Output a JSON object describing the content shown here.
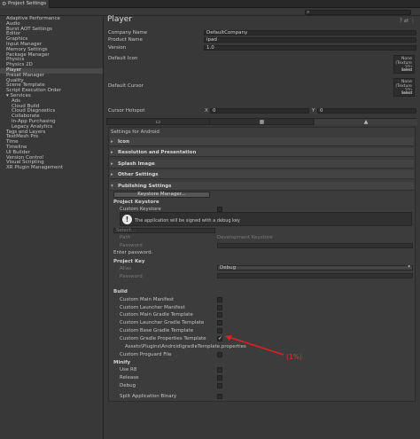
{
  "window": {
    "tab_title": "Project Settings"
  },
  "sidebar": {
    "items": [
      {
        "label": "Adaptive Performance",
        "sub": false,
        "selected": false
      },
      {
        "label": "Audio",
        "sub": false,
        "selected": false
      },
      {
        "label": "Burst AOT Settings",
        "sub": false,
        "selected": false
      },
      {
        "label": "Editor",
        "sub": false,
        "selected": false
      },
      {
        "label": "Graphics",
        "sub": false,
        "selected": false
      },
      {
        "label": "Input Manager",
        "sub": false,
        "selected": false
      },
      {
        "label": "Memory Settings",
        "sub": false,
        "selected": false
      },
      {
        "label": "Package Manager",
        "sub": false,
        "selected": false
      },
      {
        "label": "Physics",
        "sub": false,
        "selected": false
      },
      {
        "label": "Physics 2D",
        "sub": false,
        "selected": false
      },
      {
        "label": "Player",
        "sub": false,
        "selected": true
      },
      {
        "label": "Preset Manager",
        "sub": false,
        "selected": false
      },
      {
        "label": "Quality",
        "sub": false,
        "selected": false
      },
      {
        "label": "Scene Template",
        "sub": false,
        "selected": false
      },
      {
        "label": "Script Execution Order",
        "sub": false,
        "selected": false
      },
      {
        "label": "▾ Services",
        "sub": false,
        "selected": false
      },
      {
        "label": "Ads",
        "sub": true,
        "selected": false
      },
      {
        "label": "Cloud Build",
        "sub": true,
        "selected": false
      },
      {
        "label": "Cloud Diagnostics",
        "sub": true,
        "selected": false
      },
      {
        "label": "Collaborate",
        "sub": true,
        "selected": false
      },
      {
        "label": "In-App Purchasing",
        "sub": true,
        "selected": false
      },
      {
        "label": "Legacy Analytics",
        "sub": true,
        "selected": false
      },
      {
        "label": "Tags and Layers",
        "sub": false,
        "selected": false
      },
      {
        "label": "TextMesh Pro",
        "sub": false,
        "selected": false
      },
      {
        "label": "Time",
        "sub": false,
        "selected": false
      },
      {
        "label": "Timeline",
        "sub": false,
        "selected": false
      },
      {
        "label": "UI Builder",
        "sub": false,
        "selected": false
      },
      {
        "label": "Version Control",
        "sub": false,
        "selected": false
      },
      {
        "label": "Visual Scripting",
        "sub": false,
        "selected": false
      },
      {
        "label": "XR Plugin Management",
        "sub": false,
        "selected": false
      }
    ]
  },
  "player": {
    "title": "Player",
    "company_name_label": "Company Name",
    "company_name_value": "DefaultCompany",
    "product_name_label": "Product Name",
    "product_name_value": "ipad",
    "version_label": "Version",
    "version_value": "1.0",
    "default_icon_label": "Default Icon",
    "default_cursor_label": "Default Cursor",
    "none_text": "None",
    "texture_text": "(Texture 2D)",
    "select_text": "Select",
    "cursor_hotspot_label": "Cursor Hotspot",
    "x_label": "X",
    "x_value": "0",
    "y_label": "Y",
    "y_value": "0"
  },
  "android": {
    "settings_label": "Settings for Android",
    "sections": {
      "icon": "Icon",
      "resolution": "Resolution and Presentation",
      "splash": "Splash Image",
      "other": "Other Settings",
      "publishing": "Publishing Settings"
    },
    "keystore_manager_button": "Keystore Manager...",
    "project_keystore_heading": "Project Keystore",
    "custom_keystore_label": "Custom Keystore",
    "debug_info_text": "The application will be signed with a debug key",
    "select_dropdown": "Select...",
    "path_label": "Path",
    "path_value": "Development Keystore",
    "password_label": "Password",
    "enter_password_text": "Enter password.",
    "project_key_heading": "Project Key",
    "alias_label": "Alias",
    "alias_value": "Debug",
    "key_password_label": "Password",
    "build_heading": "Build",
    "build_items": [
      {
        "label": "Custom Main Manifest",
        "checked": false
      },
      {
        "label": "Custom Launcher Manifest",
        "checked": false
      },
      {
        "label": "Custom Main Gradle Template",
        "checked": false
      },
      {
        "label": "Custom Launcher Gradle Template",
        "checked": false
      },
      {
        "label": "Custom Base Gradle Template",
        "checked": false
      },
      {
        "label": "Custom Gradle Properties Template",
        "checked": true
      }
    ],
    "gradle_path": "Assets\\Plugins\\Android\\gradleTemplate.properties",
    "custom_proguard_label": "Custom Proguard File",
    "minify_heading": "Minify",
    "minify_items": [
      {
        "label": "Use R8"
      },
      {
        "label": "Release"
      },
      {
        "label": "Debug"
      }
    ],
    "split_binary_label": "Split Application Binary"
  },
  "annotation": {
    "text": "(1%)",
    "color": "#e03030"
  }
}
